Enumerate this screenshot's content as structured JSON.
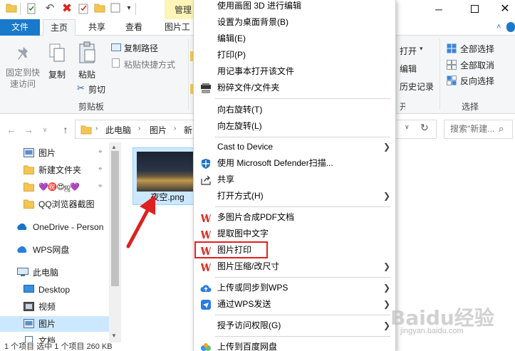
{
  "titlebar": {
    "quick_access_icons": [
      "folder-icon",
      "checkmark-icon",
      "undo-icon",
      "delete-icon",
      "properties-icon",
      "folder-icon",
      "checkbox-icon",
      "dropdown-arrow-icon"
    ],
    "contextual_tab": "管理",
    "contextual_tab_color": "#fdf4b6",
    "window_buttons": [
      "minimize-icon",
      "maximize-icon",
      "close-icon"
    ]
  },
  "ribbon_tabs": {
    "file": "文件",
    "home": "主页",
    "share": "共享",
    "view": "查看",
    "picture_tools": "图片工"
  },
  "ribbon": {
    "clipboard": {
      "pin": "固定到快\n速访问",
      "copy": "复制",
      "paste": "粘贴",
      "copy_path": "复制路径",
      "paste_shortcut": "粘贴快捷方式",
      "cut": "剪切",
      "group_label": "剪贴板"
    },
    "open_group": {
      "open": "打开",
      "edit": "编辑",
      "history": "历史记录"
    },
    "select_group": {
      "select_all": "全部选择",
      "select_none": "全部取消",
      "invert": "反向选择",
      "group_label": "选择"
    }
  },
  "address": {
    "path": [
      "此电脑",
      "图片",
      "新"
    ],
    "search_placeholder": "搜索\"新建..."
  },
  "nav": {
    "items": [
      {
        "label": "图片",
        "pinned": true
      },
      {
        "label": "新建文件夹",
        "pinned": true
      },
      {
        "label": "💜㊗️😍ஜ💜",
        "pinned": true
      },
      {
        "label": "QQ浏览器截图",
        "pinned": false
      },
      {
        "label": "OneDrive - Person",
        "pinned": false
      },
      {
        "label": "WPS网盘",
        "pinned": false
      },
      {
        "label": "此电脑",
        "pinned": false
      },
      {
        "label": "Desktop",
        "pinned": false
      },
      {
        "label": "视频",
        "pinned": false
      },
      {
        "label": "图片",
        "pinned": false
      },
      {
        "label": "文档",
        "pinned": false
      }
    ]
  },
  "file": {
    "name": "夜空.png"
  },
  "status": {
    "text": "1 个项目    选中 1 个项目  260 KB"
  },
  "context_menu": {
    "items": [
      {
        "label": "使用画图 3D 进行编辑",
        "icon": "",
        "submenu": false
      },
      {
        "label": "设置为桌面背景(B)",
        "icon": "",
        "submenu": false
      },
      {
        "label": "编辑(E)",
        "icon": "",
        "submenu": false
      },
      {
        "label": "打印(P)",
        "icon": "",
        "submenu": false
      },
      {
        "label": "用记事本打开该文件",
        "icon": "",
        "submenu": false
      },
      {
        "label": "粉碎文件/文件夹",
        "icon": "shredder-icon",
        "submenu": false
      },
      {
        "label": "向右旋转(T)",
        "icon": "",
        "submenu": false
      },
      {
        "label": "向左旋转(L)",
        "icon": "",
        "submenu": false
      },
      {
        "label": "Cast to Device",
        "icon": "",
        "submenu": true
      },
      {
        "label": "使用 Microsoft Defender扫描...",
        "icon": "defender-shield-icon",
        "submenu": false
      },
      {
        "label": "共享",
        "icon": "share-icon",
        "submenu": false
      },
      {
        "label": "打开方式(H)",
        "icon": "",
        "submenu": true
      },
      {
        "label": "多图片合成PDF文档",
        "icon": "wps-icon",
        "submenu": false
      },
      {
        "label": "提取图中文字",
        "icon": "wps-icon",
        "submenu": false
      },
      {
        "label": "图片打印",
        "icon": "wps-icon",
        "submenu": false
      },
      {
        "label": "图片压缩/改尺寸",
        "icon": "wps-icon",
        "submenu": true
      },
      {
        "label": "上传或同步到WPS",
        "icon": "cloud-upload-icon",
        "submenu": true
      },
      {
        "label": "通过WPS发送",
        "icon": "wps-send-icon",
        "submenu": true
      },
      {
        "label": "授予访问权限(G)",
        "icon": "",
        "submenu": true
      },
      {
        "label": "上传到百度网盘",
        "icon": "baidu-netdisk-icon",
        "submenu": false
      }
    ],
    "highlighted": "图片打印",
    "highlight_color": "#e02020"
  },
  "watermark": {
    "text": "Baidu经验",
    "sub": "jingyan.baidu.com"
  },
  "colors": {
    "file_tab": "#1979ca",
    "selection": "#cce8ff",
    "arrow": "#e02020",
    "wps": "#d9342b"
  }
}
